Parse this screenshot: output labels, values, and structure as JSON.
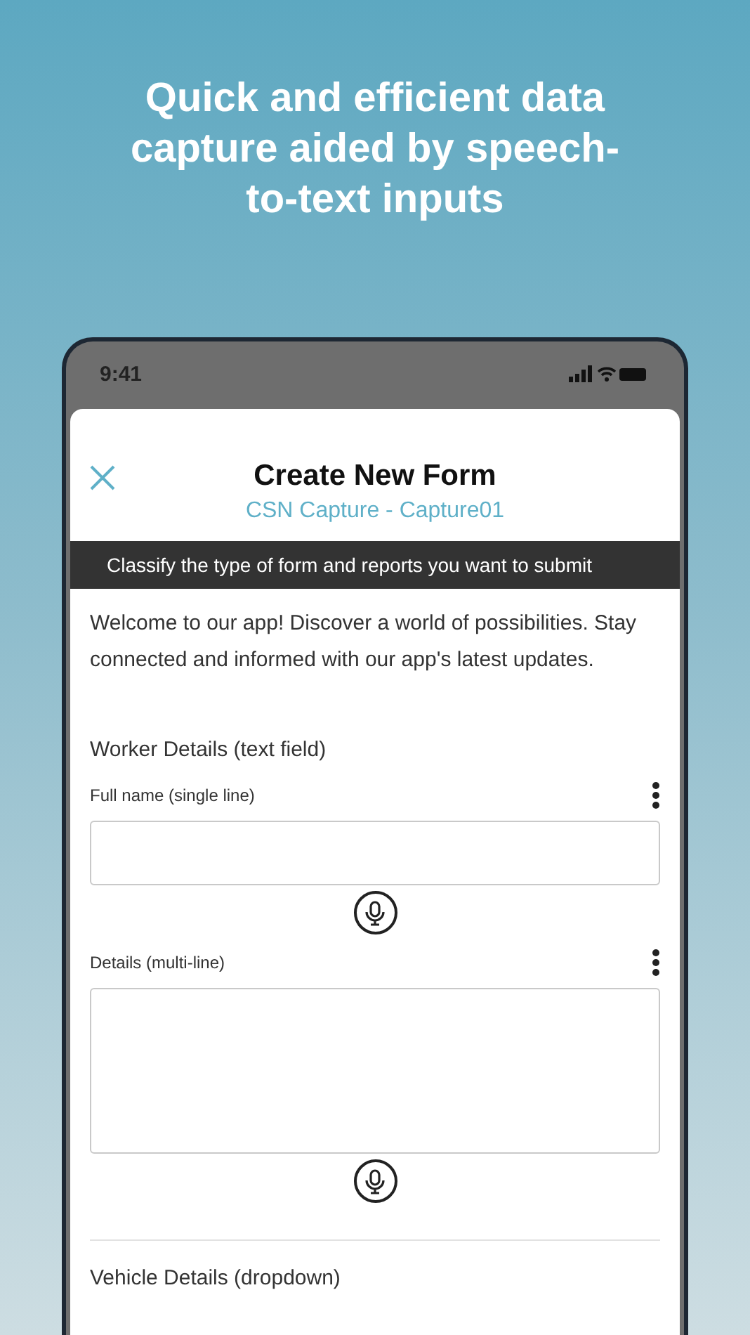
{
  "headline": "Quick and efficient data capture aided by speech-to-text inputs",
  "status_bar": {
    "time": "9:41"
  },
  "form": {
    "title": "Create New Form",
    "subtitle": "CSN Capture - Capture01",
    "banner": "Classify the type of form and reports you want to submit",
    "intro": "Welcome to our app! Discover a world of possibilities. Stay connected and informed with our app's latest updates.",
    "sections": [
      {
        "title": "Worker Details (text field)",
        "fields": [
          {
            "label": "Full name (single line)",
            "kind": "single"
          },
          {
            "label": "Details (multi-line)",
            "kind": "multi"
          }
        ]
      },
      {
        "title": "Vehicle Details (dropdown)"
      }
    ]
  }
}
